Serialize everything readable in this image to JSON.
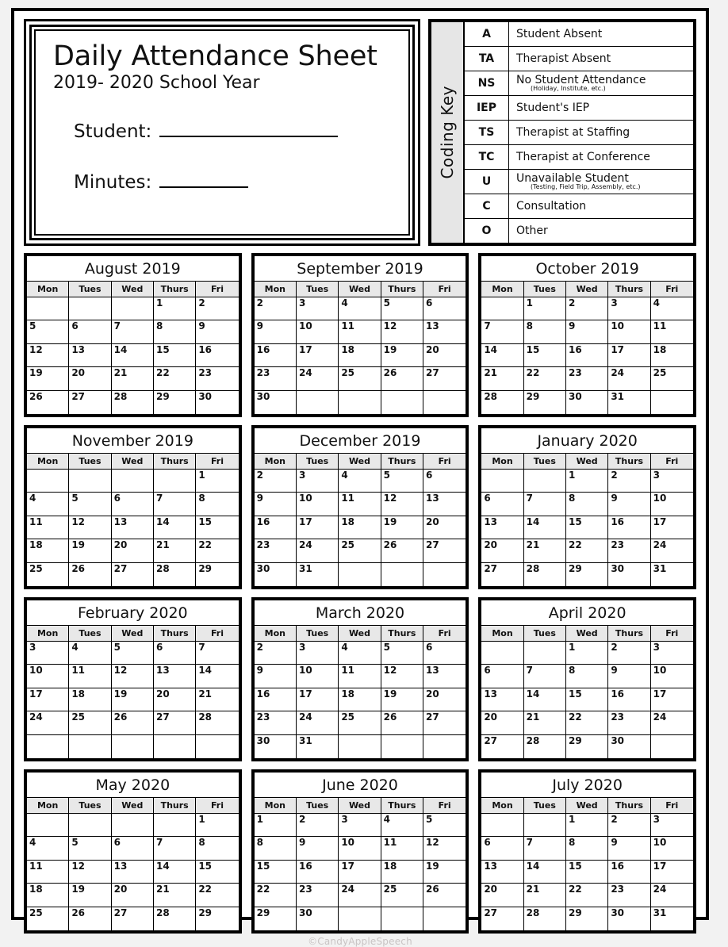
{
  "title_box": {
    "title": "Daily Attendance Sheet",
    "subtitle": "2019- 2020 School Year",
    "student_label": "Student:",
    "minutes_label": "Minutes:"
  },
  "coding_key": {
    "vertical_label": "Coding Key",
    "rows": [
      {
        "code": "A",
        "description": "Student Absent",
        "note": ""
      },
      {
        "code": "TA",
        "description": "Therapist Absent",
        "note": ""
      },
      {
        "code": "NS",
        "description": "No Student Attendance",
        "note": "(Holiday, Institute, etc.)"
      },
      {
        "code": "IEP",
        "description": "Student's IEP",
        "note": ""
      },
      {
        "code": "TS",
        "description": "Therapist at Staffing",
        "note": ""
      },
      {
        "code": "TC",
        "description": "Therapist at Conference",
        "note": ""
      },
      {
        "code": "U",
        "description": "Unavailable Student",
        "note": "(Testing, Field Trip, Assembly, etc.)"
      },
      {
        "code": "C",
        "description": "Consultation",
        "note": ""
      },
      {
        "code": "O",
        "description": "Other",
        "note": ""
      }
    ]
  },
  "calendar": {
    "weekday_headers": [
      "Mon",
      "Tues",
      "Wed",
      "Thurs",
      "Fri"
    ],
    "months": [
      {
        "title": "August 2019",
        "weeks": [
          [
            "",
            "",
            "",
            "1",
            "2"
          ],
          [
            "5",
            "6",
            "7",
            "8",
            "9"
          ],
          [
            "12",
            "13",
            "14",
            "15",
            "16"
          ],
          [
            "19",
            "20",
            "21",
            "22",
            "23"
          ],
          [
            "26",
            "27",
            "28",
            "29",
            "30"
          ]
        ]
      },
      {
        "title": "September 2019",
        "weeks": [
          [
            "2",
            "3",
            "4",
            "5",
            "6"
          ],
          [
            "9",
            "10",
            "11",
            "12",
            "13"
          ],
          [
            "16",
            "17",
            "18",
            "19",
            "20"
          ],
          [
            "23",
            "24",
            "25",
            "26",
            "27"
          ],
          [
            "30",
            "",
            "",
            "",
            ""
          ]
        ]
      },
      {
        "title": "October 2019",
        "weeks": [
          [
            "",
            "1",
            "2",
            "3",
            "4"
          ],
          [
            "7",
            "8",
            "9",
            "10",
            "11"
          ],
          [
            "14",
            "15",
            "16",
            "17",
            "18"
          ],
          [
            "21",
            "22",
            "23",
            "24",
            "25"
          ],
          [
            "28",
            "29",
            "30",
            "31",
            ""
          ]
        ]
      },
      {
        "title": "November 2019",
        "weeks": [
          [
            "",
            "",
            "",
            "",
            "1"
          ],
          [
            "4",
            "5",
            "6",
            "7",
            "8"
          ],
          [
            "11",
            "12",
            "13",
            "14",
            "15"
          ],
          [
            "18",
            "19",
            "20",
            "21",
            "22"
          ],
          [
            "25",
            "26",
            "27",
            "28",
            "29"
          ]
        ]
      },
      {
        "title": "December 2019",
        "weeks": [
          [
            "2",
            "3",
            "4",
            "5",
            "6"
          ],
          [
            "9",
            "10",
            "11",
            "12",
            "13"
          ],
          [
            "16",
            "17",
            "18",
            "19",
            "20"
          ],
          [
            "23",
            "24",
            "25",
            "26",
            "27"
          ],
          [
            "30",
            "31",
            "",
            "",
            ""
          ]
        ]
      },
      {
        "title": "January 2020",
        "weeks": [
          [
            "",
            "",
            "1",
            "2",
            "3"
          ],
          [
            "6",
            "7",
            "8",
            "9",
            "10"
          ],
          [
            "13",
            "14",
            "15",
            "16",
            "17"
          ],
          [
            "20",
            "21",
            "22",
            "23",
            "24"
          ],
          [
            "27",
            "28",
            "29",
            "30",
            "31"
          ]
        ]
      },
      {
        "title": "February 2020",
        "weeks": [
          [
            "3",
            "4",
            "5",
            "6",
            "7"
          ],
          [
            "10",
            "11",
            "12",
            "13",
            "14"
          ],
          [
            "17",
            "18",
            "19",
            "20",
            "21"
          ],
          [
            "24",
            "25",
            "26",
            "27",
            "28"
          ],
          [
            "",
            "",
            "",
            "",
            ""
          ]
        ]
      },
      {
        "title": "March 2020",
        "weeks": [
          [
            "2",
            "3",
            "4",
            "5",
            "6"
          ],
          [
            "9",
            "10",
            "11",
            "12",
            "13"
          ],
          [
            "16",
            "17",
            "18",
            "19",
            "20"
          ],
          [
            "23",
            "24",
            "25",
            "26",
            "27"
          ],
          [
            "30",
            "31",
            "",
            "",
            ""
          ]
        ]
      },
      {
        "title": "April 2020",
        "weeks": [
          [
            "",
            "",
            "1",
            "2",
            "3"
          ],
          [
            "6",
            "7",
            "8",
            "9",
            "10"
          ],
          [
            "13",
            "14",
            "15",
            "16",
            "17"
          ],
          [
            "20",
            "21",
            "22",
            "23",
            "24"
          ],
          [
            "27",
            "28",
            "29",
            "30",
            ""
          ]
        ]
      },
      {
        "title": "May 2020",
        "weeks": [
          [
            "",
            "",
            "",
            "",
            "1"
          ],
          [
            "4",
            "5",
            "6",
            "7",
            "8"
          ],
          [
            "11",
            "12",
            "13",
            "14",
            "15"
          ],
          [
            "18",
            "19",
            "20",
            "21",
            "22"
          ],
          [
            "25",
            "26",
            "27",
            "28",
            "29"
          ]
        ]
      },
      {
        "title": "June 2020",
        "weeks": [
          [
            "1",
            "2",
            "3",
            "4",
            "5"
          ],
          [
            "8",
            "9",
            "10",
            "11",
            "12"
          ],
          [
            "15",
            "16",
            "17",
            "18",
            "19"
          ],
          [
            "22",
            "23",
            "24",
            "25",
            "26"
          ],
          [
            "29",
            "30",
            "",
            "",
            ""
          ]
        ]
      },
      {
        "title": "July 2020",
        "weeks": [
          [
            "",
            "",
            "1",
            "2",
            "3"
          ],
          [
            "6",
            "7",
            "8",
            "9",
            "10"
          ],
          [
            "13",
            "14",
            "15",
            "16",
            "17"
          ],
          [
            "20",
            "21",
            "22",
            "23",
            "24"
          ],
          [
            "27",
            "28",
            "29",
            "30",
            "31"
          ]
        ]
      }
    ]
  },
  "footer": {
    "credit": "©CandyAppleSpeech"
  },
  "colors": {
    "ink": "#111111",
    "border": "#000000",
    "header_fill": "#e8e8e8",
    "key_label_fill": "#e6e6e6",
    "page_bg": "#ffffff",
    "margin_bg": "#f2f2f2",
    "footer_text": "#c9c4c4"
  }
}
